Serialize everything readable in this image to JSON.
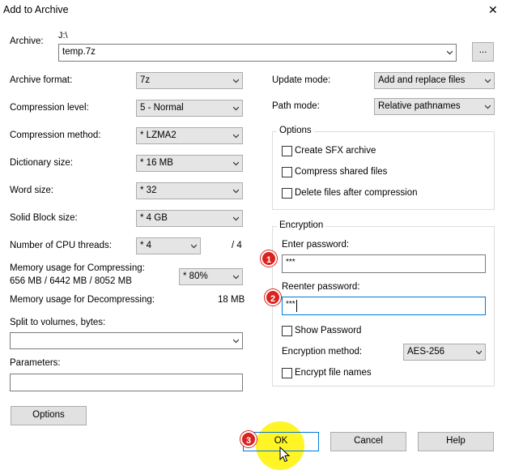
{
  "window": {
    "title": "Add to Archive",
    "close_glyph": "✕"
  },
  "archive": {
    "label": "Archive:",
    "path": "J:\\",
    "name": "temp.7z",
    "browse_label": "..."
  },
  "left": {
    "archive_format": {
      "label": "Archive format:",
      "value": "7z"
    },
    "compression_level": {
      "label": "Compression level:",
      "value": "5 - Normal"
    },
    "compression_method": {
      "label": "Compression method:",
      "value": "*  LZMA2"
    },
    "dictionary_size": {
      "label": "Dictionary size:",
      "value": "*  16 MB"
    },
    "word_size": {
      "label": "Word size:",
      "value": "*  32"
    },
    "solid_block_size": {
      "label": "Solid Block size:",
      "value": "*  4 GB"
    },
    "cpu_threads": {
      "label": "Number of CPU threads:",
      "value": "*  4",
      "max": "/ 4"
    },
    "memory_compress": {
      "label_line1": "Memory usage for Compressing:",
      "label_line2": "656 MB / 6442 MB / 8052 MB",
      "value": "* 80%"
    },
    "memory_decompress": {
      "label": "Memory usage for Decompressing:",
      "value": "18 MB"
    },
    "split": {
      "label": "Split to volumes, bytes:",
      "value": ""
    },
    "parameters": {
      "label": "Parameters:",
      "value": ""
    },
    "options_button": "Options"
  },
  "right": {
    "update_mode": {
      "label": "Update mode:",
      "value": "Add and replace files"
    },
    "path_mode": {
      "label": "Path mode:",
      "value": "Relative pathnames"
    },
    "options_group": {
      "title": "Options",
      "create_sfx": "Create SFX archive",
      "compress_shared": "Compress shared files",
      "delete_after": "Delete files after compression"
    },
    "encryption": {
      "title": "Encryption",
      "enter_password_label": "Enter password:",
      "enter_password_value": "***",
      "reenter_password_label": "Reenter password:",
      "reenter_password_value": "***",
      "show_password": "Show Password",
      "method_label": "Encryption method:",
      "method_value": "AES-256",
      "encrypt_names": "Encrypt file names"
    }
  },
  "buttons": {
    "ok": "OK",
    "cancel": "Cancel",
    "help": "Help"
  },
  "annotations": {
    "badge1": "1",
    "badge2": "2",
    "badge3": "3"
  },
  "colors": {
    "badge_red": "#d9231e",
    "focus_blue": "#0078d7",
    "cursor_highlight": "#fff200"
  }
}
